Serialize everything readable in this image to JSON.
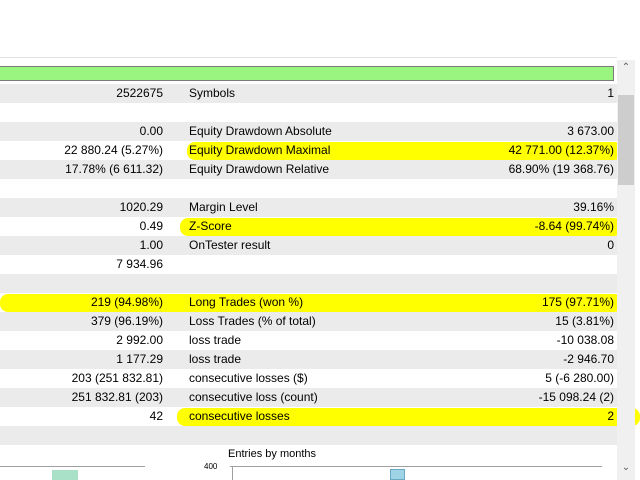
{
  "progress": {
    "value": 1.0,
    "color": "#99f57f"
  },
  "rows": [
    {
      "v1": "2522675",
      "label": "Symbols",
      "v2": "1"
    },
    {
      "v1": "",
      "label": "",
      "v2": ""
    },
    {
      "v1": "0.00",
      "label": "Equity Drawdown Absolute",
      "v2": "3 673.00"
    },
    {
      "v1": "22 880.24 (5.27%)",
      "label": "Equity Drawdown Maximal",
      "v2": "42 771.00 (12.37%)"
    },
    {
      "v1": "17.78% (6 611.32)",
      "label": "Equity Drawdown Relative",
      "v2": "68.90% (19 368.76)"
    },
    {
      "v1": "",
      "label": "",
      "v2": ""
    },
    {
      "v1": "1020.29",
      "label": "Margin Level",
      "v2": "39.16%"
    },
    {
      "v1": "0.49",
      "label": "Z-Score",
      "v2": "-8.64 (99.74%)"
    },
    {
      "v1": "1.00",
      "label": "OnTester result",
      "v2": "0"
    },
    {
      "v1": "7 934.96",
      "label": "",
      "v2": ""
    },
    {
      "v1": "",
      "label": "",
      "v2": ""
    },
    {
      "v1": "219 (94.98%)",
      "label": "Long Trades (won %)",
      "v2": "175 (97.71%)"
    },
    {
      "v1": "379 (96.19%)",
      "label": "Loss Trades (% of total)",
      "v2": "15 (3.81%)"
    },
    {
      "v1": "2 992.00",
      "label": "loss trade",
      "v2": "-10 038.08"
    },
    {
      "v1": "1 177.29",
      "label": "loss trade",
      "v2": "-2 946.70"
    },
    {
      "v1": "203 (251 832.81)",
      "label": "consecutive losses ($)",
      "v2": "5 (-6 280.00)"
    },
    {
      "v1": "251 832.81 (203)",
      "label": "consecutive loss (count)",
      "v2": "-15 098.24 (2)"
    },
    {
      "v1": "42",
      "label": "consecutive losses",
      "v2": "2"
    },
    {
      "v1": "",
      "label": "",
      "v2": ""
    }
  ],
  "highlight_color": "#ffff00",
  "chart": {
    "title": "Entries by months",
    "tick_top": "400"
  },
  "scroll": {
    "up": "⌃",
    "down": "⌄"
  }
}
